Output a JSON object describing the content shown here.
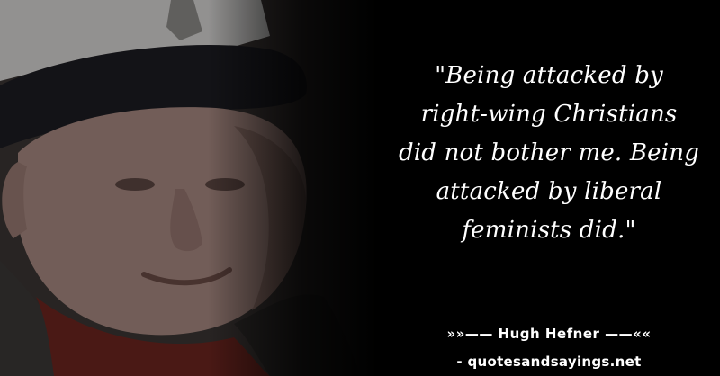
{
  "quote": {
    "lines": [
      "\"Being attacked by",
      "right-wing Christians",
      "did not bother me. Being",
      "attacked by liberal",
      "feminists did.\""
    ]
  },
  "attribution": "»»—— Hugh Hefner ——««",
  "source": "- quotesandsayings.net",
  "colors": {
    "background": "#000000",
    "text": "#ffffff",
    "cap": "#1b1a1f",
    "skin": "#b08c80",
    "shirt": "#7a2a22",
    "jacket": "#3a3735"
  }
}
